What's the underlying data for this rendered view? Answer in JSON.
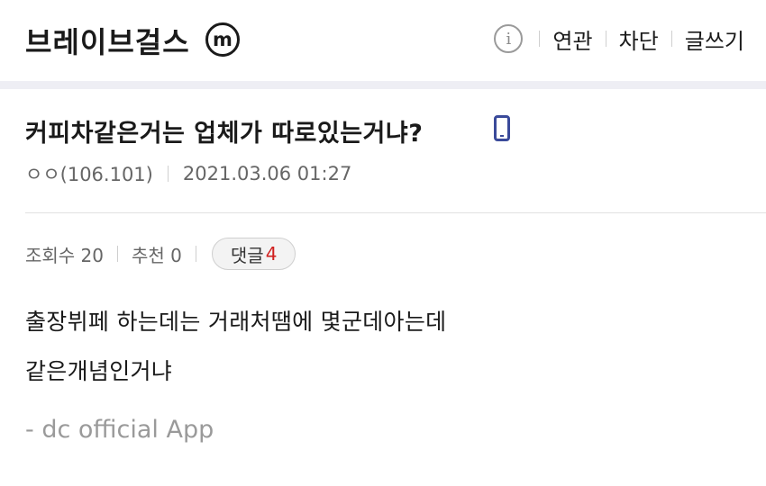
{
  "header": {
    "gallery_title": "브레이브걸스",
    "minor_badge": "m",
    "info_icon": "info-circle-icon",
    "actions": [
      "연관",
      "차단",
      "글쓰기"
    ]
  },
  "post": {
    "title": "커피차같은거는 업체가 따로있는거냐?",
    "device_icon": "mobile-phone-icon",
    "author": "ㅇㅇ(106.101)",
    "datetime": "2021.03.06 01:27",
    "views_label": "조회수 20",
    "recommend_label": "추천 0",
    "comment_label": "댓글",
    "comment_count": "4",
    "body_lines": [
      "출장뷔페 하는데는 거래처땜에 몇군데아는데",
      "같은개념인거냐"
    ],
    "signature": "- dc official App"
  },
  "colors": {
    "band": "#eeeef4",
    "comment_count": "#d0201f",
    "device_icon": "#3a4a9a"
  }
}
